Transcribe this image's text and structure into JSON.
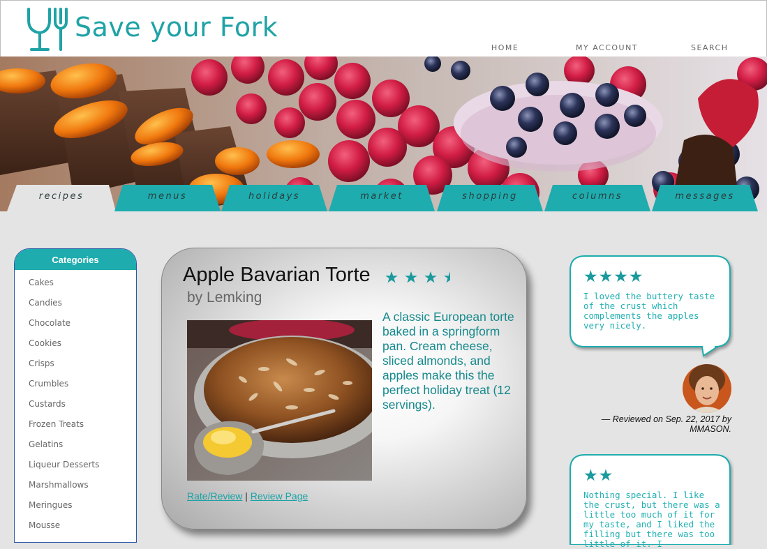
{
  "site": {
    "logo_text": "Save your Fork"
  },
  "topnav": [
    {
      "label": "HOME"
    },
    {
      "label": "MY ACCOUNT"
    },
    {
      "label": "SEARCH"
    }
  ],
  "tabs": [
    {
      "label": "recipes",
      "active": true
    },
    {
      "label": "menus",
      "active": false
    },
    {
      "label": "holidays",
      "active": false
    },
    {
      "label": "market",
      "active": false
    },
    {
      "label": "shopping",
      "active": false
    },
    {
      "label": "columns",
      "active": false
    },
    {
      "label": "messages",
      "active": false
    }
  ],
  "sidebar": {
    "title": "Categories",
    "items": [
      {
        "label": "Cakes"
      },
      {
        "label": "Candies"
      },
      {
        "label": "Chocolate"
      },
      {
        "label": "Cookies"
      },
      {
        "label": "Crisps"
      },
      {
        "label": "Crumbles"
      },
      {
        "label": "Custards"
      },
      {
        "label": "Frozen Treats"
      },
      {
        "label": "Gelatins"
      },
      {
        "label": "Liqueur Desserts"
      },
      {
        "label": "Marshmallows"
      },
      {
        "label": "Meringues"
      },
      {
        "label": "Mousse"
      }
    ]
  },
  "recipe": {
    "title": "Apple Bavarian Torte",
    "rating": 3.5,
    "author": "by Lemking",
    "description": "A classic European torte baked in a springform pan. Cream cheese, sliced almonds, and apples make this the perfect holiday treat (12 servings).",
    "rate_link": "Rate/Review",
    "separator": "|",
    "review_link": "Review Page"
  },
  "reviews": [
    {
      "stars": "★★★★",
      "text": "I loved the buttery taste of the crust which complements the apples very nicely.",
      "byline": "— Reviewed on Sep. 22, 2017 by MMASON."
    },
    {
      "stars": "★★",
      "text": "Nothing special. I like the crust, but there was a little too much of it for my taste, and I liked the filling but there was too little of it. I"
    }
  ],
  "colors": {
    "accent": "#1eacae",
    "tab_teal": "#1eacae",
    "text_teal": "#16898c"
  },
  "icons": {
    "logo": "fork-glass-icon",
    "rating": "star-icon"
  }
}
